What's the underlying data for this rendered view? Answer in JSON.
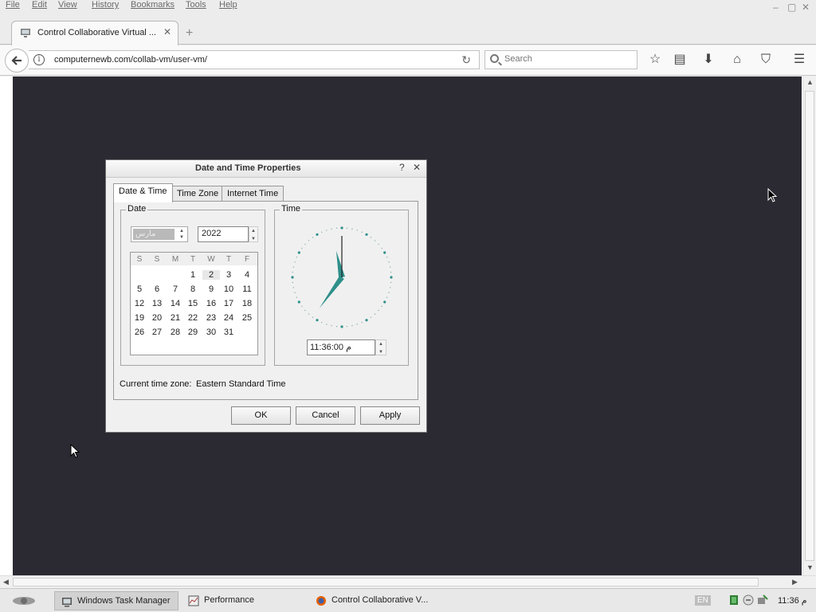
{
  "menubar": {
    "items": [
      "File",
      "Edit",
      "View",
      "History",
      "Bookmarks",
      "Tools",
      "Help"
    ],
    "controls": [
      "–",
      "▢",
      "✕"
    ]
  },
  "tab": {
    "title": "Control Collaborative Virtual ...",
    "close": "✕",
    "new_tab": "+"
  },
  "navbar": {
    "url": "computernewb.com/collab-vm/user-vm/",
    "info_glyph": "i",
    "reload_glyph": "↻",
    "search_placeholder": "Search",
    "toolbar_glyphs": {
      "bookmark": "☆",
      "reading_list": "▤",
      "download": "⬇",
      "home": "⌂",
      "pocket": "⛉",
      "menu": "☰"
    }
  },
  "dialog": {
    "title": "Date and Time Properties",
    "help": "?",
    "close": "✕",
    "tabs": [
      "Date & Time",
      "Time Zone",
      "Internet Time"
    ],
    "date_group": "Date",
    "time_group": "Time",
    "month": "مارس",
    "year": "2022",
    "weekday_headers": [
      "S",
      "S",
      "M",
      "T",
      "W",
      "T",
      "F"
    ],
    "calendar_rows": [
      [
        "",
        "",
        "",
        "1",
        "2",
        "3",
        "4"
      ],
      [
        "5",
        "6",
        "7",
        "8",
        "9",
        "10",
        "11"
      ],
      [
        "12",
        "13",
        "14",
        "15",
        "16",
        "17",
        "18"
      ],
      [
        "19",
        "20",
        "21",
        "22",
        "23",
        "24",
        "25"
      ],
      [
        "26",
        "27",
        "28",
        "29",
        "30",
        "31",
        ""
      ]
    ],
    "selected_day": "2",
    "time": "11:36:00 م",
    "timezone_label": "Current time zone:",
    "timezone_value": "Eastern Standard Time",
    "buttons": {
      "ok": "OK",
      "cancel": "Cancel",
      "apply": "Apply"
    }
  },
  "taskbar": {
    "items": [
      "Windows Task Manager",
      "Performance",
      "Control Collaborative V..."
    ],
    "language": "EN",
    "clock": "11:36 م"
  },
  "colors": {
    "vm_background": "#2b2a33",
    "clock_hands": "#2e8f8a",
    "window_chrome": "#ececec"
  }
}
